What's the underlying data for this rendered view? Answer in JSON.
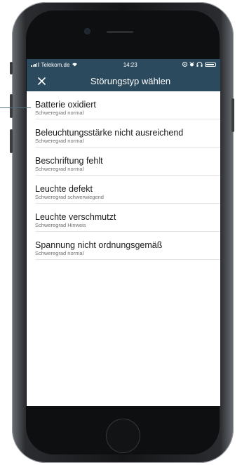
{
  "status_bar": {
    "carrier": "Telekom.de",
    "time": "14:23",
    "icons": [
      "signal-icon",
      "wifi-icon",
      "location-icon",
      "alarm-icon",
      "headphones-icon",
      "battery-icon"
    ]
  },
  "nav": {
    "close_icon": "close-icon",
    "title": "Störungstyp wählen"
  },
  "items": [
    {
      "title": "Batterie oxidiert",
      "severity": "Schweregrad normal"
    },
    {
      "title": "Beleuchtungsstärke nicht ausreichend",
      "severity": "Schweregrad normal"
    },
    {
      "title": "Beschriftung fehlt",
      "severity": "Schweregrad normal"
    },
    {
      "title": "Leuchte defekt",
      "severity": "Schweregrad schwerwiegend"
    },
    {
      "title": "Leuchte verschmutzt",
      "severity": "Schweregrad Hinweis"
    },
    {
      "title": "Spannung nicht ordnungsgemäß",
      "severity": "Schweregrad normal"
    }
  ],
  "colors": {
    "header": "#2b4a5e",
    "callout": "#4f7183"
  }
}
